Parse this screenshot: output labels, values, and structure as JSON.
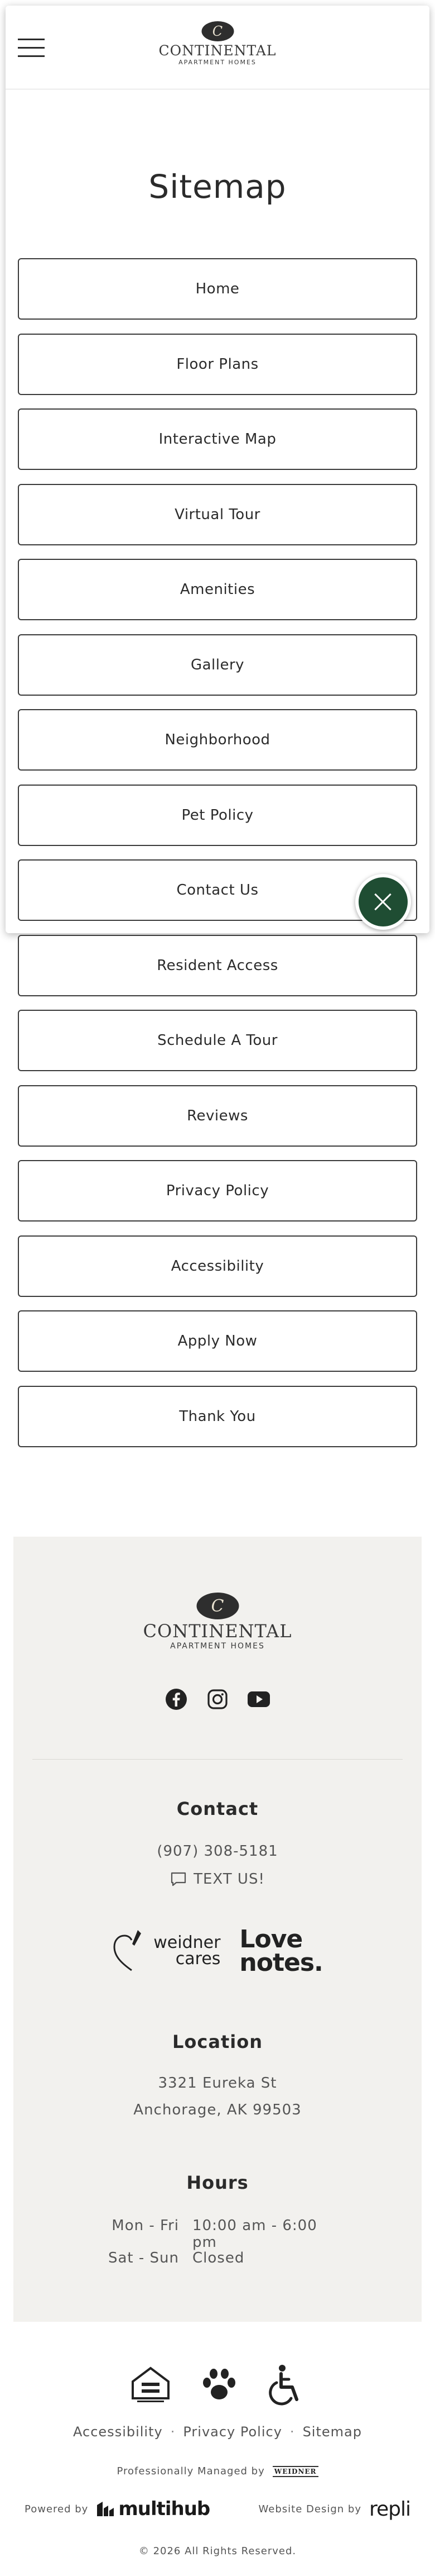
{
  "header": {
    "logo_mark": "C",
    "logo_name": "CONTINENTAL",
    "logo_sub": "APARTMENT HOMES"
  },
  "page": {
    "title": "Sitemap"
  },
  "sitemap": {
    "links": [
      "Home",
      "Floor Plans",
      "Interactive Map",
      "Virtual Tour",
      "Amenities",
      "Gallery",
      "Neighborhood",
      "Pet Policy",
      "Contact Us",
      "Resident Access",
      "Schedule A Tour",
      "Reviews",
      "Privacy Policy",
      "Accessibility",
      "Apply Now",
      "Thank You"
    ]
  },
  "footer": {
    "logo_mark": "C",
    "logo_name": "CONTINENTAL",
    "logo_sub": "APARTMENT HOMES",
    "socials": [
      "facebook-icon",
      "instagram-icon",
      "youtube-icon"
    ],
    "contact_title": "Contact",
    "phone": "(907) 308-5181",
    "text_us": "TEXT US!",
    "weidner_cares_1": "weidner",
    "weidner_cares_2": "cares",
    "love_notes_1": "Love",
    "love_notes_2": "notes.",
    "location_title": "Location",
    "address_1": "3321 Eureka St",
    "address_2": "Anchorage, AK 99503",
    "hours_title": "Hours",
    "hours": [
      {
        "day": "Mon - Fri",
        "time": "10:00 am - 6:00 pm"
      },
      {
        "day": "Sat - Sun",
        "time": "Closed"
      }
    ]
  },
  "bottom": {
    "links": [
      "Accessibility",
      "Privacy Policy",
      "Sitemap"
    ],
    "separator": "·",
    "managed_by": "Professionally Managed by",
    "weidner_small": "WEIDNER",
    "powered_by": "Powered by",
    "multihub": "multihub",
    "design_by": "Website Design by",
    "repli": "repli",
    "copyright": "© 2026 All Rights Reserved."
  },
  "colors": {
    "fab": "#1f4d33",
    "footer_bg": "#f2f1ee",
    "text": "#2b2b2b"
  }
}
